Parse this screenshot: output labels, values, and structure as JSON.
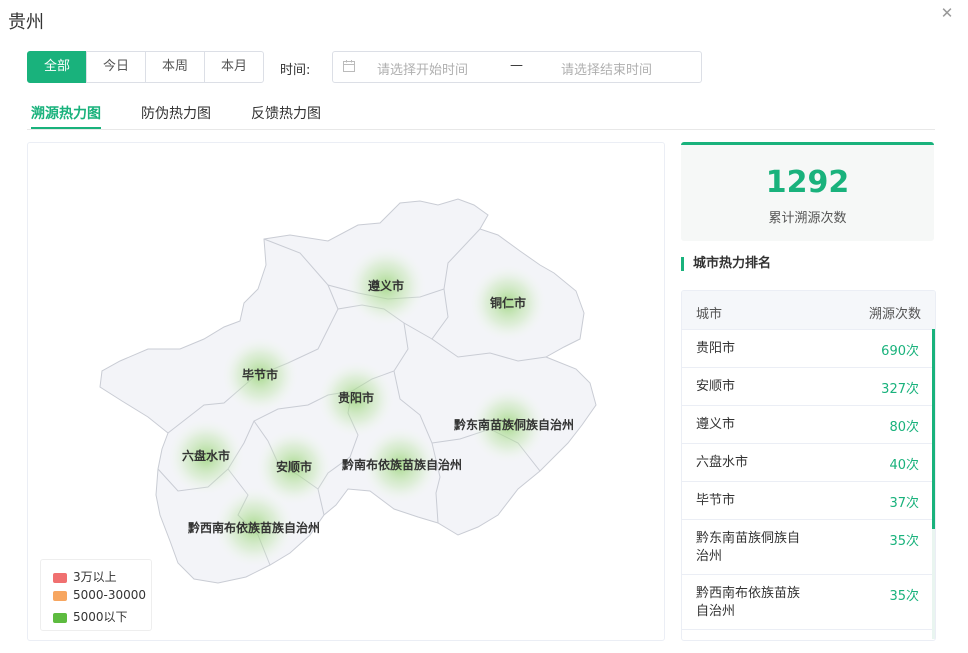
{
  "window": {
    "title": "贵州"
  },
  "filters": {
    "ranges": [
      "全部",
      "今日",
      "本周",
      "本月"
    ],
    "active_range": "全部",
    "time_label": "时间:",
    "start_placeholder": "请选择开始时间",
    "separator": "—",
    "end_placeholder": "请选择结束时间"
  },
  "tabs": [
    {
      "label": "溯源热力图",
      "active": true
    },
    {
      "label": "防伪热力图",
      "active": false
    },
    {
      "label": "反馈热力图",
      "active": false
    }
  ],
  "map": {
    "cities": [
      "遵义市",
      "铜仁市",
      "毕节市",
      "贵阳市",
      "黔东南苗族侗族自治州",
      "六盘水市",
      "安顺市",
      "黔南布依族苗族自治州",
      "黔西南布依族苗族自治州"
    ],
    "legend": [
      {
        "label": "3万以上",
        "color": "#f07070"
      },
      {
        "label": "5000-30000",
        "color": "#f7a660"
      },
      {
        "label": "5000以下",
        "color": "#5dbb3f"
      }
    ]
  },
  "stats": {
    "total": "1292",
    "total_label": "累计溯源次数"
  },
  "ranking": {
    "title": "城市热力排名",
    "col_city": "城市",
    "col_count": "溯源次数",
    "rows": [
      {
        "city": "贵阳市",
        "count": "690次"
      },
      {
        "city": "安顺市",
        "count": "327次"
      },
      {
        "city": "遵义市",
        "count": "80次"
      },
      {
        "city": "六盘水市",
        "count": "40次"
      },
      {
        "city": "毕节市",
        "count": "37次"
      },
      {
        "city": "黔东南苗族侗族自治州",
        "count": "35次"
      },
      {
        "city": "黔西南布依族苗族自治州",
        "count": "35次"
      }
    ]
  },
  "colors": {
    "accent": "#19b27c"
  }
}
